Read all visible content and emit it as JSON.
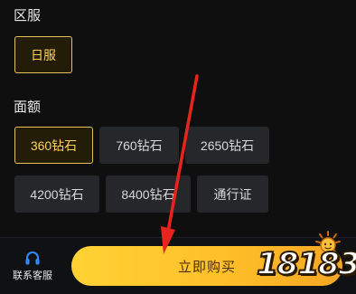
{
  "region": {
    "title": "区服",
    "options": [
      {
        "label": "日服",
        "selected": true
      }
    ]
  },
  "amount": {
    "title": "面额",
    "options": [
      {
        "label": "360钻石",
        "selected": true
      },
      {
        "label": "760钻石",
        "selected": false
      },
      {
        "label": "2650钻石",
        "selected": false
      },
      {
        "label": "4200钻石",
        "selected": false
      },
      {
        "label": "8400钻石",
        "selected": false
      },
      {
        "label": "通行证",
        "selected": false
      }
    ]
  },
  "footer": {
    "support_label": "联系客服",
    "support_icon": "headset-icon",
    "buy_label": "立即购买"
  },
  "watermark": {
    "text": "18183",
    "icon": "sun-mascot-icon"
  },
  "colors": {
    "accent": "#ffd35a",
    "button": "#ffc02a",
    "annotation_arrow": "#e8241c"
  }
}
